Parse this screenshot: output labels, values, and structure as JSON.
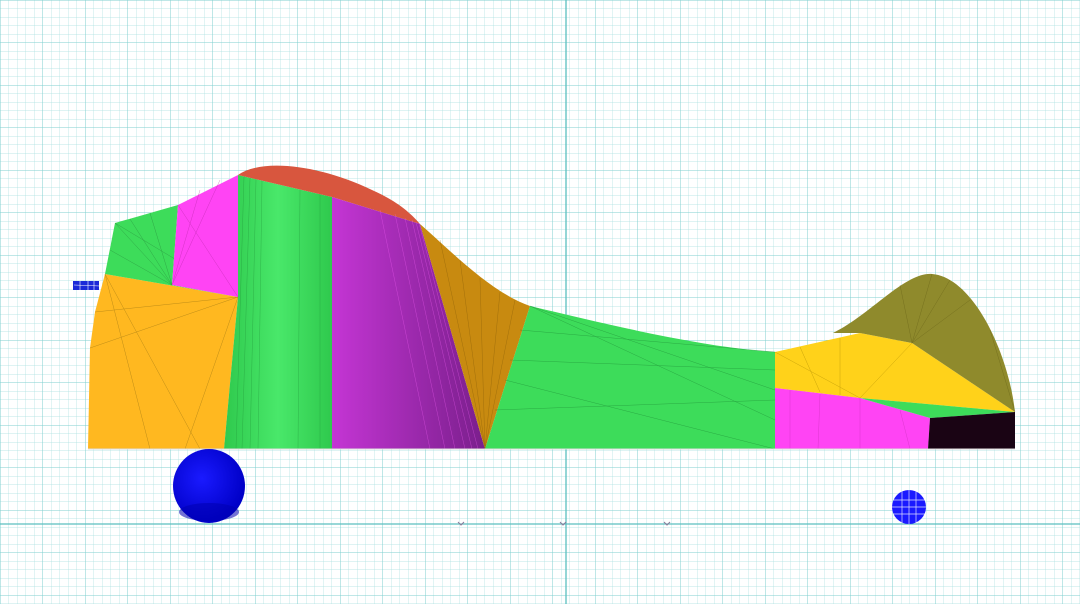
{
  "viewport": {
    "background_color": "#ffffff",
    "grid_minor_color": "#a9e0e0",
    "grid_major_color": "#7fcfcf",
    "axis_color": "#5bbfbf"
  },
  "fuselage": {
    "colors": {
      "orange_panel": "#ffb820",
      "green_panel": "#3ddc5a",
      "magenta_panel": "#ff44f4",
      "purple_panel": "#b52cc6",
      "canopy_red": "#d8563e",
      "bronze_panel": "#c88a10",
      "olive_tail": "#8f8a2c",
      "yellow_stabilizer": "#ffd21a",
      "dark_tail_cap": "#1a0414",
      "mesh_line": "#555555"
    }
  },
  "gear": {
    "main_wheel": {
      "icon": "main-wheel-icon",
      "color": "#0000f0"
    },
    "tail_wheel": {
      "icon": "tail-wheel-icon",
      "color": "#1a1aff"
    },
    "prop_stub": {
      "icon": "propeller-stub-icon",
      "color": "#1a2ad8"
    }
  }
}
